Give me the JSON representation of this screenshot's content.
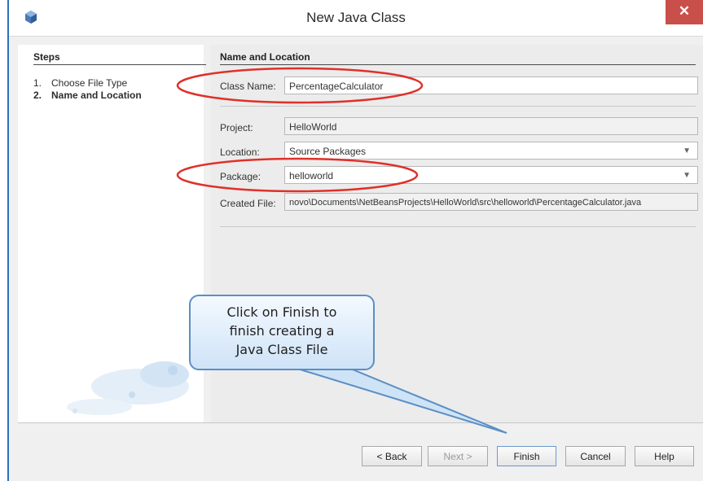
{
  "window": {
    "title": "New Java Class",
    "close_label": "✕"
  },
  "steps": {
    "heading": "Steps",
    "items": [
      {
        "number": "1.",
        "label": "Choose File Type"
      },
      {
        "number": "2.",
        "label": "Name and Location"
      }
    ]
  },
  "form": {
    "heading": "Name and Location",
    "class_name": {
      "label": "Class Name:",
      "value": "PercentageCalculator"
    },
    "project": {
      "label": "Project:",
      "value": "HelloWorld"
    },
    "location": {
      "label": "Location:",
      "value": "Source Packages"
    },
    "package": {
      "label": "Package:",
      "value": "helloworld"
    },
    "created_file": {
      "label": "Created File:",
      "value": "novo\\Documents\\NetBeansProjects\\HelloWorld\\src\\helloworld\\PercentageCalculator.java"
    }
  },
  "buttons": {
    "back": "< Back",
    "next": "Next >",
    "finish": "Finish",
    "cancel": "Cancel",
    "help": "Help"
  },
  "callout": {
    "lines": [
      "Click on Finish to",
      "finish creating a",
      "Java Class File"
    ]
  },
  "colors": {
    "highlight_ellipse": "#e0302a",
    "callout_border": "#5b8fc4",
    "close_button": "#c94f4a"
  }
}
